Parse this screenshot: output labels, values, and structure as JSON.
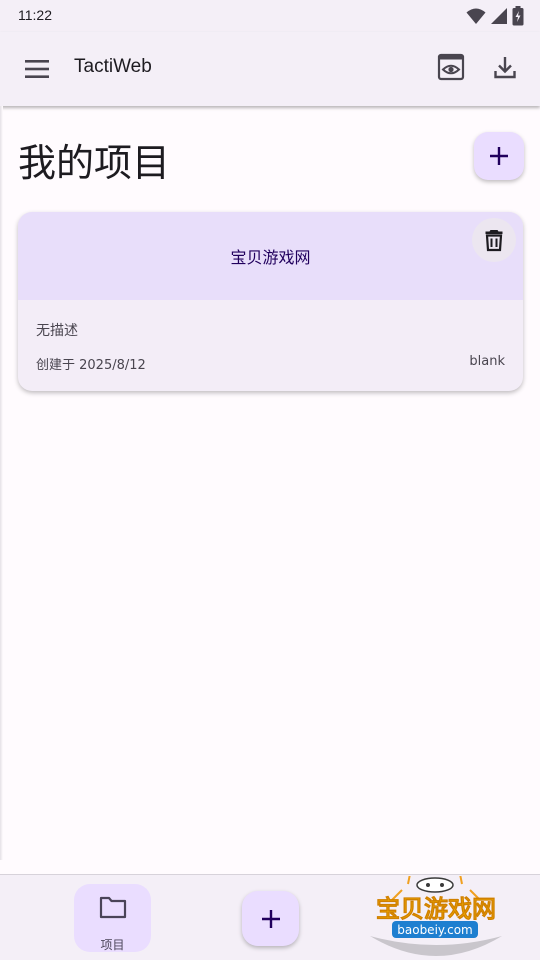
{
  "status_bar": {
    "time": "11:22"
  },
  "app_bar": {
    "title": "TactiWeb",
    "icons": [
      "menu-icon",
      "preview-icon",
      "download-icon"
    ]
  },
  "page": {
    "title": "我的项目"
  },
  "projects": [
    {
      "name": "宝贝游戏网",
      "description": "无描述",
      "created": "创建于 2025/8/12",
      "template": "blank"
    }
  ],
  "bottom_nav": {
    "projects_label": "项目"
  },
  "watermark": {
    "brand": "宝贝游戏网",
    "url": "baobeiy.com"
  },
  "colors": {
    "accent": "#eaddff",
    "surface": "#f4eff7",
    "on_accent": "#21005d"
  }
}
